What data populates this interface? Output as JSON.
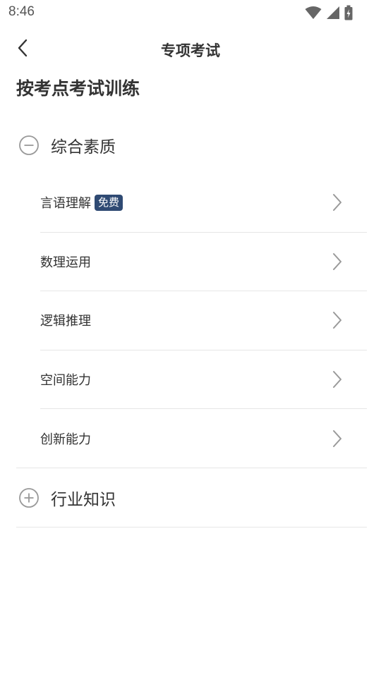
{
  "status_bar": {
    "time": "8:46"
  },
  "header": {
    "title": "专项考试"
  },
  "section": {
    "title": "按考点考试训练"
  },
  "categories": [
    {
      "label": "综合素质",
      "expanded": true,
      "items": [
        {
          "label": "言语理解",
          "badge": "免费"
        },
        {
          "label": "数理运用"
        },
        {
          "label": "逻辑推理"
        },
        {
          "label": "空间能力"
        },
        {
          "label": "创新能力"
        }
      ]
    },
    {
      "label": "行业知识",
      "expanded": false
    }
  ],
  "colors": {
    "badge_bg": "#2f4a73",
    "divider": "#e6e6e6",
    "icon": "#999999"
  }
}
